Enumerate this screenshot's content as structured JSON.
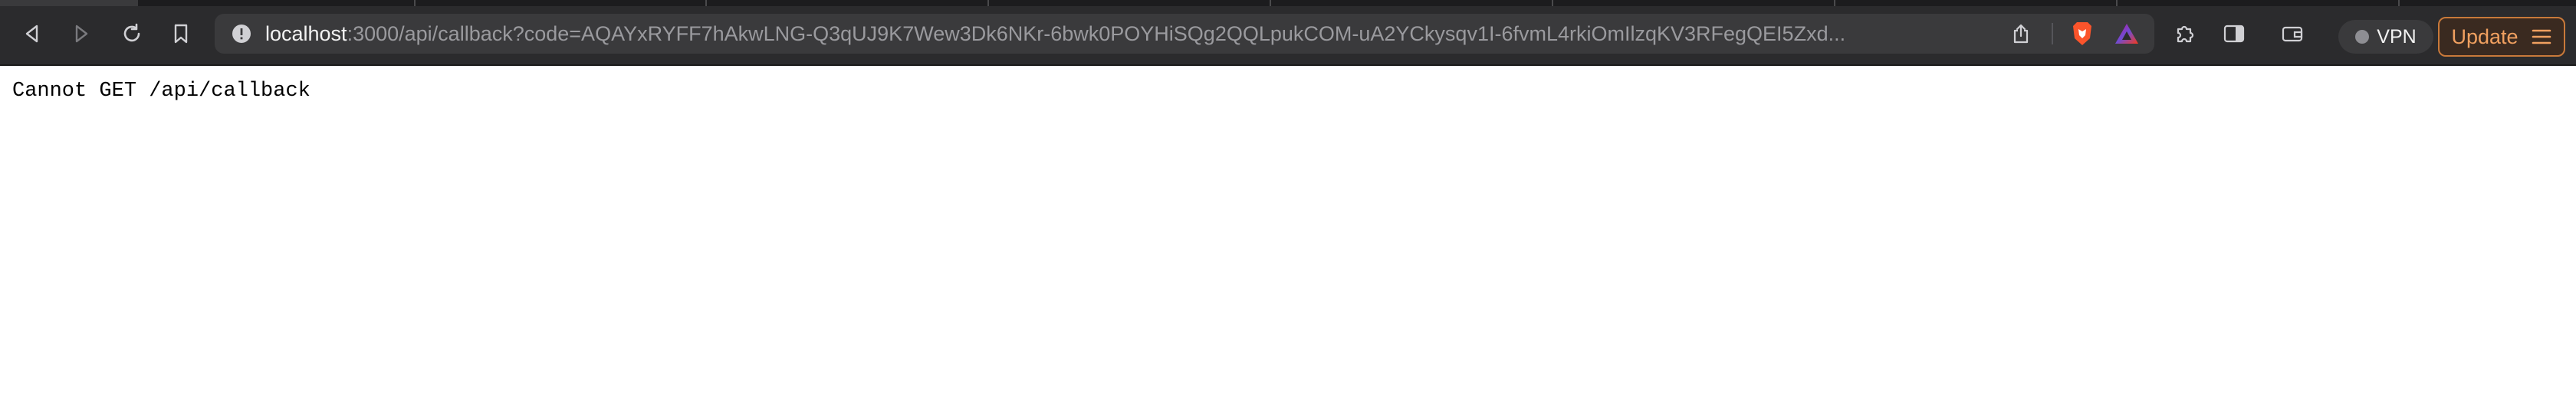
{
  "browser": {
    "url_host": "localhost",
    "url_rest": ":3000/api/callback?code=AQAYxRYFF7hAkwLNG-Q3qUJ9K7Wew3Dk6NKr-6bwk0POYHiSQg2QQLpukCOM-uA2YCkysqv1I-6fvmL4rkiOmIlzqKV3RFegQEI5Zxd...",
    "vpn_label": "VPN",
    "update_label": "Update",
    "accent_update": "#f0a060"
  },
  "page": {
    "message": "Cannot GET /api/callback"
  }
}
